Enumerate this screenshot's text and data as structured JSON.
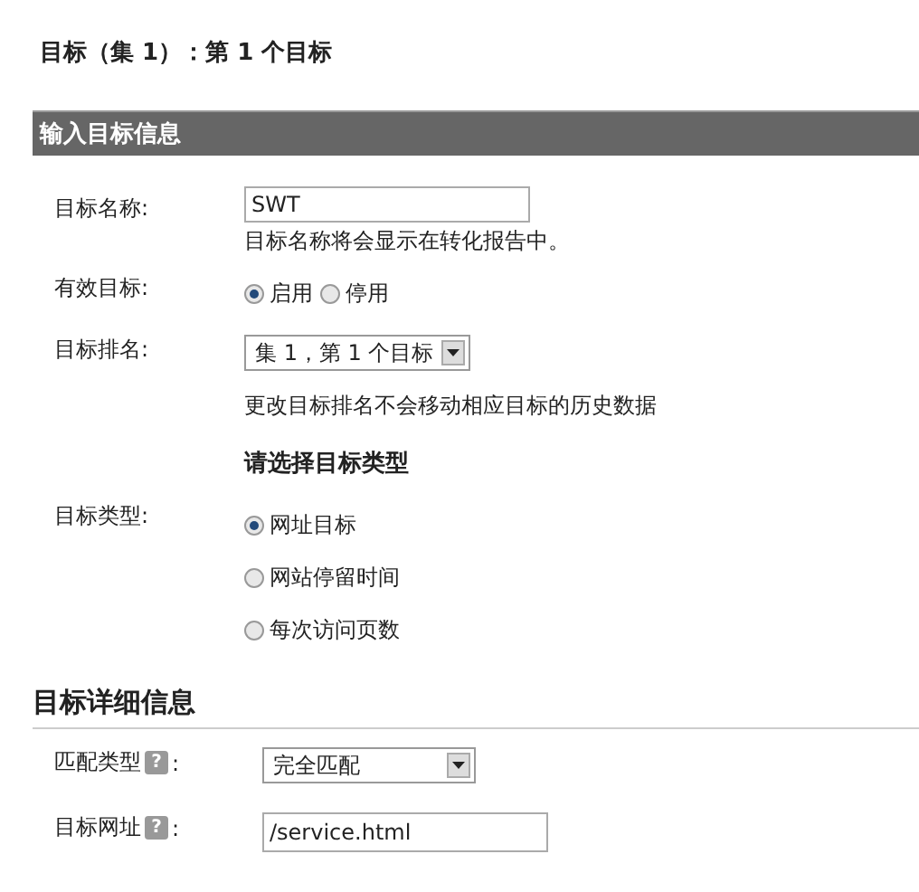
{
  "title": "目标（集 1）：第 1 个目标",
  "section_bar": "输入目标信息",
  "goal_name": {
    "label": "目标名称:",
    "value": "SWT",
    "hint": "目标名称将会显示在转化报告中。"
  },
  "active_goal": {
    "label": "有效目标:",
    "options": [
      {
        "label": "启用",
        "selected": true
      },
      {
        "label": "停用",
        "selected": false
      }
    ]
  },
  "goal_rank": {
    "label": "目标排名:",
    "value": "集 1，第 1 个目标",
    "hint": "更改目标排名不会移动相应目标的历史数据"
  },
  "goal_type": {
    "heading": "请选择目标类型",
    "label": "目标类型:",
    "options": [
      {
        "label": "网址目标",
        "selected": true
      },
      {
        "label": "网站停留时间",
        "selected": false
      },
      {
        "label": "每次访问页数",
        "selected": false
      }
    ]
  },
  "details": {
    "heading": "目标详细信息",
    "fields": [
      {
        "kind": "select",
        "label": "匹配类型",
        "help": "?",
        "colon": ":",
        "value": "完全匹配"
      },
      {
        "kind": "input",
        "label": "目标网址",
        "help": "?",
        "colon": ":",
        "value": "/service.html"
      }
    ]
  }
}
